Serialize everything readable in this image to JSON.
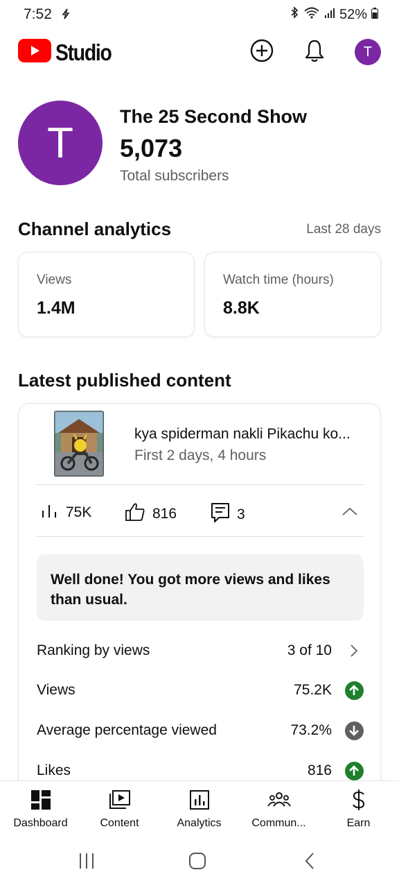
{
  "status_bar": {
    "time": "7:52",
    "battery": "52%"
  },
  "header": {
    "logo_text": "Studio",
    "avatar_letter": "T"
  },
  "channel": {
    "avatar_letter": "T",
    "name": "The 25 Second Show",
    "subscribers": "5,073",
    "subscribers_label": "Total subscribers"
  },
  "analytics": {
    "title": "Channel analytics",
    "period": "Last 28 days",
    "cards": [
      {
        "label": "Views",
        "value": "1.4M"
      },
      {
        "label": "Watch time (hours)",
        "value": "8.8K"
      }
    ]
  },
  "latest": {
    "title": "Latest published content",
    "video_title": "kya spiderman nakli Pikachu ko...",
    "video_subtitle": "First 2 days, 4 hours",
    "stats": {
      "views": "75K",
      "likes": "816",
      "comments": "3"
    },
    "banner": "Well done! You got more views and likes than usual.",
    "rows": [
      {
        "label": "Ranking by views",
        "value": "3 of 10",
        "icon": "chevron-right-icon"
      },
      {
        "label": "Views",
        "value": "75.2K",
        "icon": "arrow-up-icon",
        "color": "#1e7f2d"
      },
      {
        "label": "Average percentage viewed",
        "value": "73.2%",
        "icon": "arrow-down-icon",
        "color": "#606060"
      },
      {
        "label": "Likes",
        "value": "816",
        "icon": "arrow-up-icon",
        "color": "#1e7f2d"
      }
    ]
  },
  "bottom_nav": {
    "items": [
      {
        "label": "Dashboard",
        "icon": "dashboard-icon"
      },
      {
        "label": "Content",
        "icon": "content-icon"
      },
      {
        "label": "Analytics",
        "icon": "analytics-icon"
      },
      {
        "label": "Commun...",
        "icon": "community-icon"
      },
      {
        "label": "Earn",
        "icon": "dollar-icon"
      }
    ]
  },
  "colors": {
    "brand_red": "#ff0000",
    "avatar_purple": "#7b27a4",
    "up_green": "#1e7f2d",
    "down_gray": "#606060"
  }
}
